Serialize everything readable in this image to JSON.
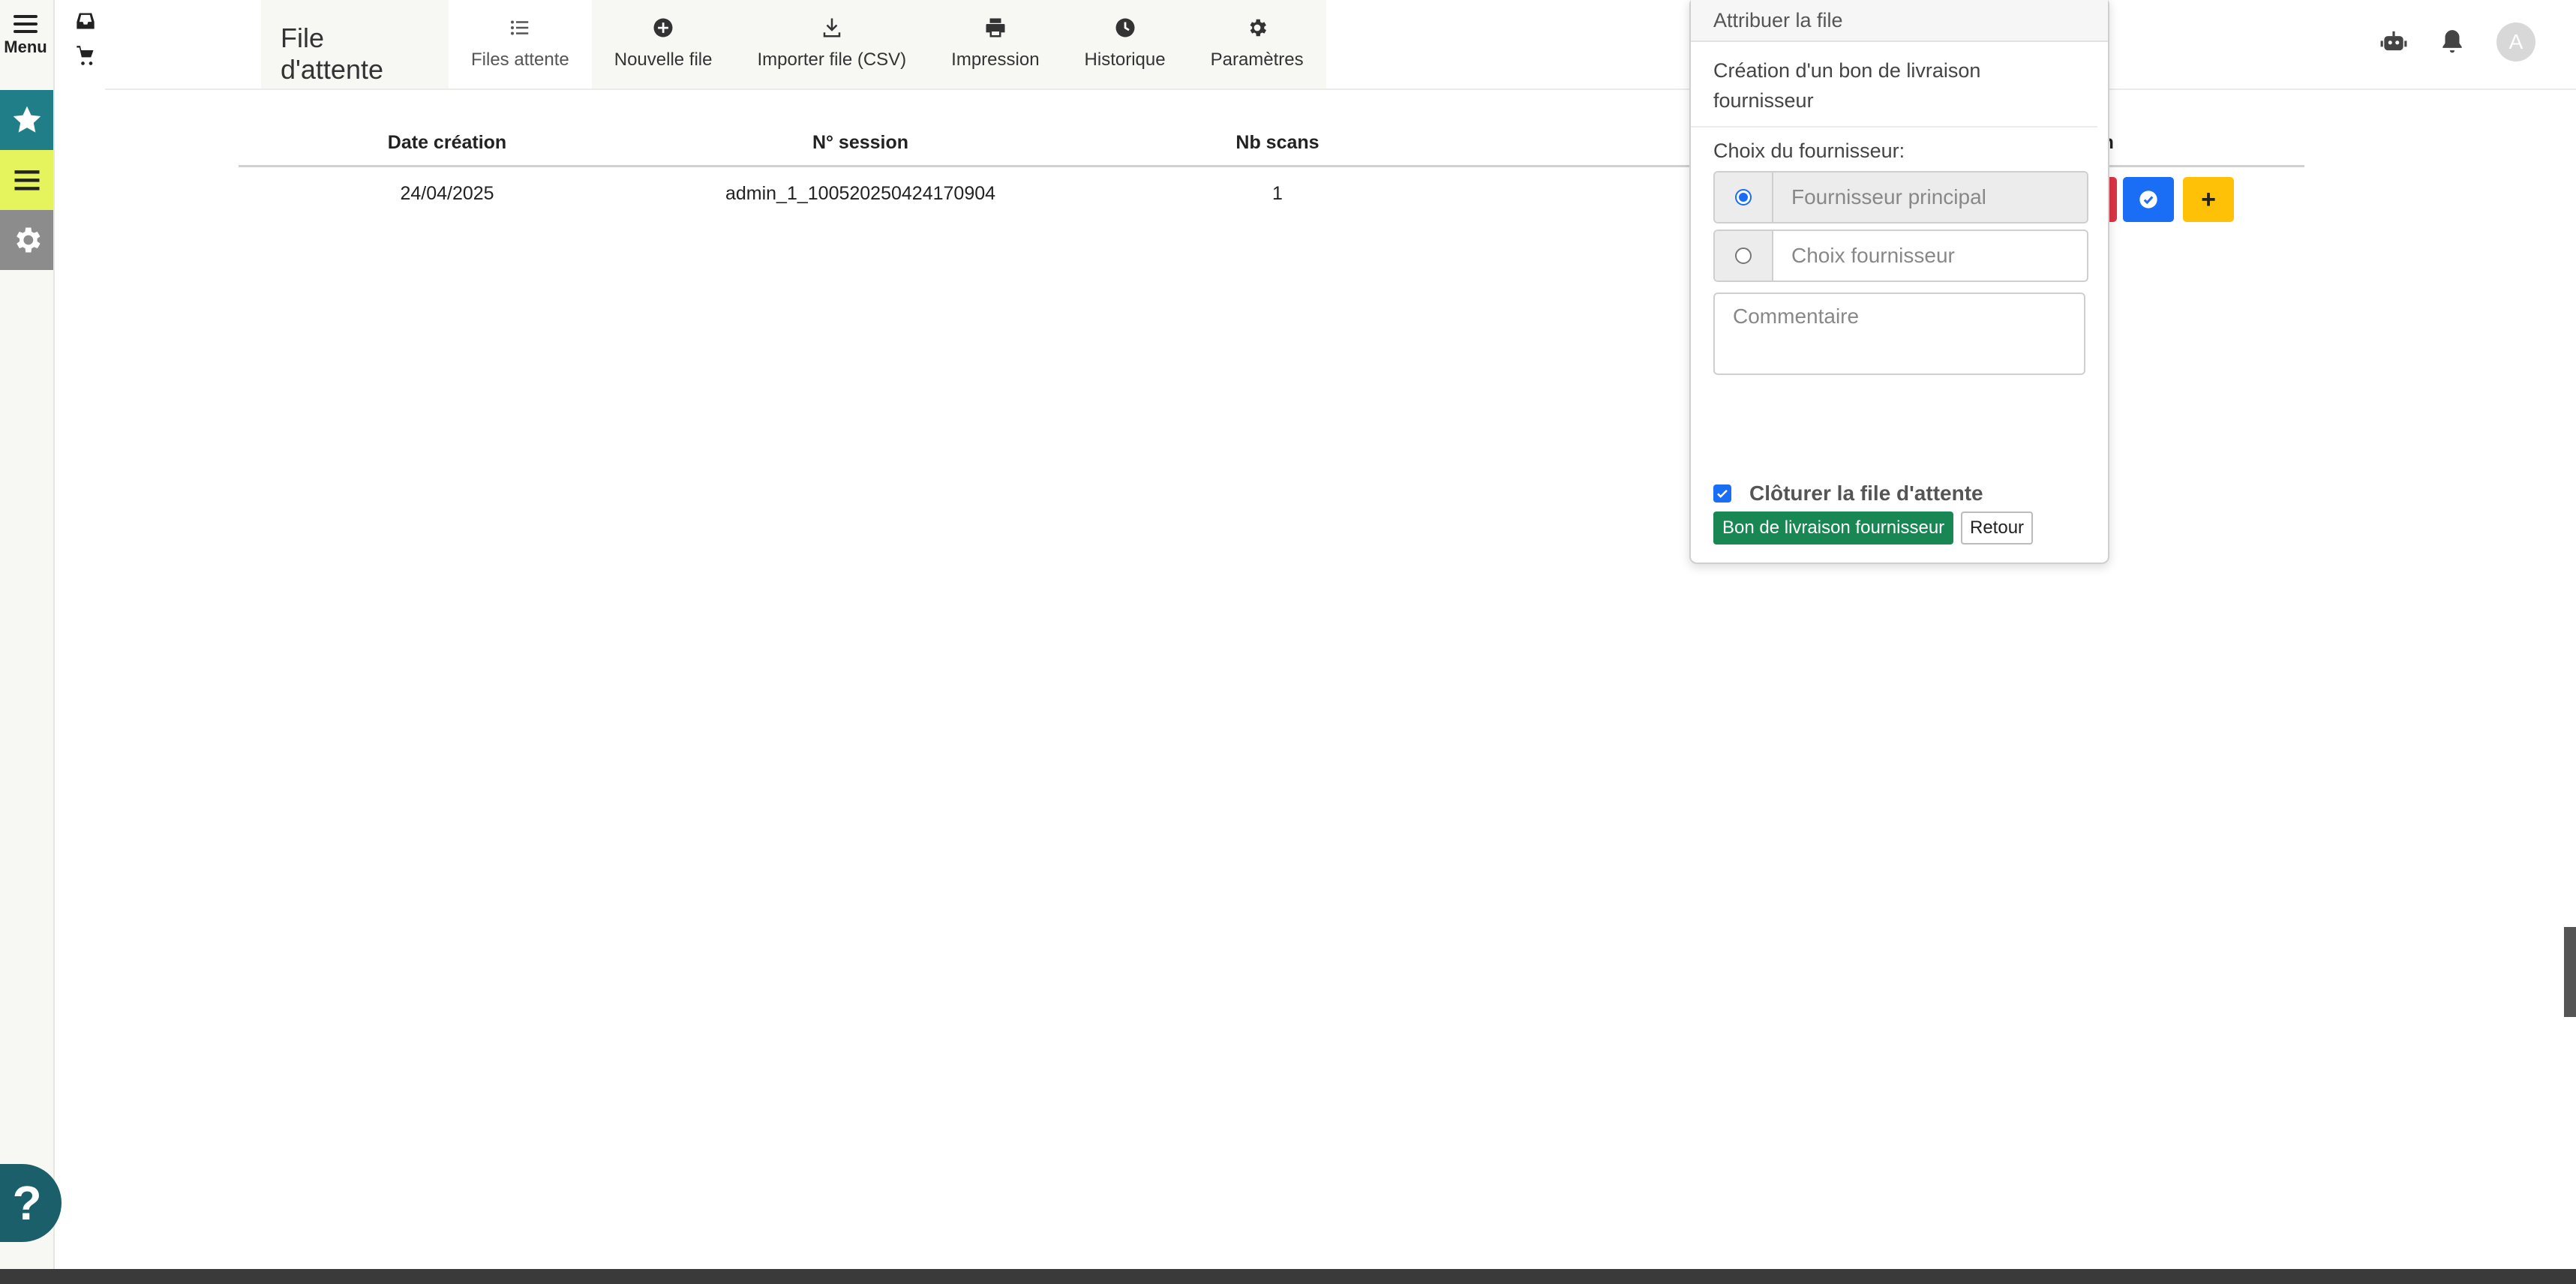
{
  "leftrail": {
    "menu_label": "Menu"
  },
  "header": {
    "title": "File d'attente",
    "tabs": [
      {
        "label": "Files attente",
        "icon": "list-icon",
        "active": true
      },
      {
        "label": "Nouvelle file",
        "icon": "plus-circle-icon"
      },
      {
        "label": "Importer file (CSV)",
        "icon": "download-icon"
      },
      {
        "label": "Impression",
        "icon": "printer-icon"
      },
      {
        "label": "Historique",
        "icon": "clock-icon"
      },
      {
        "label": "Paramètres",
        "icon": "gear-icon"
      }
    ],
    "avatar_letter": "A"
  },
  "table": {
    "headers": [
      "Date création",
      "N° session",
      "Nb scans",
      "",
      "Action"
    ],
    "rows": [
      {
        "date": "24/04/2025",
        "session": "admin_1_100520250424170904",
        "scans": "1"
      }
    ],
    "add_label": "+"
  },
  "popup": {
    "title": "Attribuer la file",
    "subtitle": "Création d'un bon de livraison fournisseur",
    "choice_label": "Choix du fournisseur:",
    "option_main": "Fournisseur principal",
    "option_choice_placeholder": "Choix fournisseur",
    "comment_placeholder": "Commentaire",
    "close_label": "Clôturer la file d'attente",
    "submit_label": "Bon de livraison fournisseur",
    "back_label": "Retour"
  },
  "help": {
    "label": "?"
  },
  "colors": {
    "teal": "#1f7e88",
    "lime": "#e5f35d",
    "primary": "#1a6ef6",
    "success": "#198754",
    "warning": "#ffc107",
    "danger": "#dc3545"
  }
}
